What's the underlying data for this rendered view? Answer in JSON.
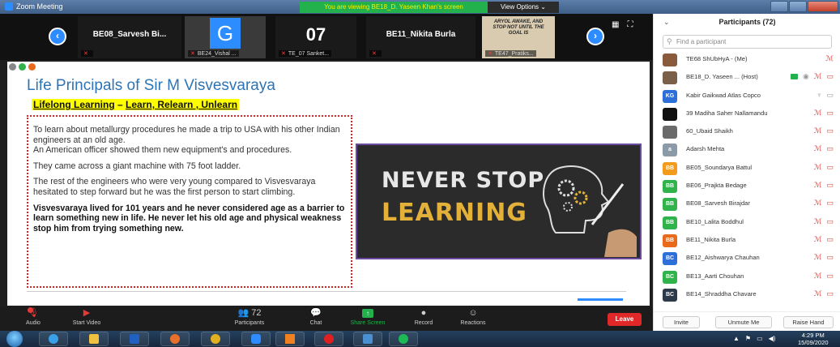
{
  "window": {
    "title": "Zoom Meeting",
    "viewing_banner": "You are viewing BE18_D. Yaseen Khan's screen",
    "view_options": "View Options ⌄"
  },
  "video_strip": {
    "prev_icon": "chevron-left-icon",
    "next_icon": "chevron-right-icon",
    "tiles": [
      {
        "name": "BE08_Sarvesh Bi...",
        "label": ""
      },
      {
        "letter": "G",
        "label": "BE24_Vishal ..."
      },
      {
        "number": "07",
        "label": "TE_07 Sanket..."
      },
      {
        "name": "BE11_Nikita Burla",
        "label": ""
      },
      {
        "image_text": "ARYOL AWAKE, AND STOP NOT UNTIL THE GOAL IS",
        "label": "TE47_Pratiks..."
      }
    ]
  },
  "slide": {
    "title": "Life Principals of Sir M Visvesvaraya",
    "subtitle_a": "Lifelong Learning",
    "subtitle_sep": " – ",
    "subtitle_b": "Learn, Relearn , Unlearn",
    "paragraphs": [
      "To learn about metallurgy procedures he made a trip to USA with his other Indian engineers at an old age.\nAn American officer showed them new equipment's and procedures.",
      "They came across a giant machine with 75 foot ladder.",
      "The rest of the engineers who were very young compared to Visvesvaraya hesitated to step forward but he was the first person to start climbing.",
      "Visvesvaraya lived for 101 years and he never considered age as a barrier to learn something new in life. He never let his old age and physical weakness stop him from trying something new."
    ],
    "image": {
      "line1": "NEVER STOP",
      "line2": "LEARNING"
    }
  },
  "toolbar": {
    "audio": "Audio",
    "start_video": "Start Video",
    "participants": "Participants",
    "participants_count": "72",
    "chat": "Chat",
    "share_screen": "Share Screen",
    "record": "Record",
    "reactions": "Reactions",
    "leave": "Leave"
  },
  "participants_panel": {
    "title": "Participants (72)",
    "search_placeholder": "Find a participant",
    "list": [
      {
        "name": "TE68 ShUbHyA - (Me)",
        "avatar": "",
        "avatar_color": "#8a5a3c"
      },
      {
        "name": "BE18_D. Yaseen ...  (Host)",
        "avatar": "",
        "avatar_color": "#7a6048"
      },
      {
        "name": "Kabir Gaikwad Atlas Copco",
        "avatar": "KG",
        "avatar_color": "#2d6fd8"
      },
      {
        "name": "39 Madiha Saher Nallamandu",
        "avatar": "",
        "avatar_color": "#111111"
      },
      {
        "name": "60_Ubaid Shaikh",
        "avatar": "",
        "avatar_color": "#6a6a6a"
      },
      {
        "name": "Adarsh Mehta",
        "avatar": "a",
        "avatar_color": "#8a9aa8"
      },
      {
        "name": "BE05_Soundarya Battul",
        "avatar": "BB",
        "avatar_color": "#f29b1d"
      },
      {
        "name": "BE06_Prajkta Bedage",
        "avatar": "BB",
        "avatar_color": "#2fb34a"
      },
      {
        "name": "BE08_Sarvesh Birajdar",
        "avatar": "BB",
        "avatar_color": "#2fb34a"
      },
      {
        "name": "BE10_Lalita Boddhul",
        "avatar": "BB",
        "avatar_color": "#2fb34a"
      },
      {
        "name": "BE11_Nikita Burla",
        "avatar": "BB",
        "avatar_color": "#e86a1a"
      },
      {
        "name": "BE12_Aishwarya Chauhan",
        "avatar": "BC",
        "avatar_color": "#2d6fd8"
      },
      {
        "name": "BE13_Aarti Chouhan",
        "avatar": "BC",
        "avatar_color": "#2fb34a"
      },
      {
        "name": "BE14_Shraddha Chavare",
        "avatar": "BC",
        "avatar_color": "#2d3a4a"
      }
    ],
    "invite": "Invite",
    "unmute_me": "Unmute Me",
    "raise_hand": "Raise Hand"
  },
  "taskbar": {
    "time": "4:29 PM",
    "date": "15/09/2020"
  }
}
